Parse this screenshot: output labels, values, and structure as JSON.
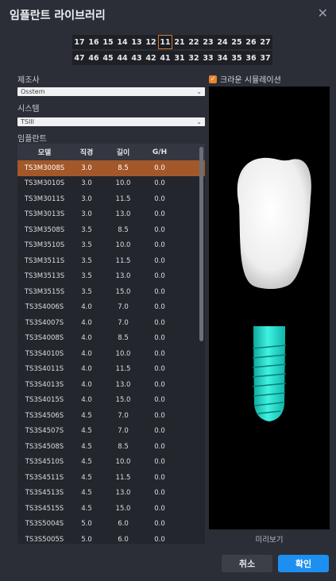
{
  "window": {
    "title": "임플란트 라이브러리"
  },
  "teeth": {
    "upper": [
      "17",
      "16",
      "15",
      "14",
      "13",
      "12",
      "11",
      "21",
      "22",
      "23",
      "24",
      "25",
      "26",
      "27"
    ],
    "lower": [
      "47",
      "46",
      "45",
      "44",
      "43",
      "42",
      "41",
      "31",
      "32",
      "33",
      "34",
      "35",
      "36",
      "37"
    ],
    "selected": "11"
  },
  "manufacturer": {
    "label": "제조사",
    "value": "Osstem"
  },
  "system": {
    "label": "시스템",
    "value": "TSIII"
  },
  "implant": {
    "label": "임플란트",
    "columns": [
      "모델",
      "직경",
      "길이",
      "G/H"
    ],
    "selected_index": 0,
    "rows": [
      [
        "TS3M3008S",
        "3.0",
        "8.5",
        "0.0"
      ],
      [
        "TS3M3010S",
        "3.0",
        "10.0",
        "0.0"
      ],
      [
        "TS3M3011S",
        "3.0",
        "11.5",
        "0.0"
      ],
      [
        "TS3M3013S",
        "3.0",
        "13.0",
        "0.0"
      ],
      [
        "TS3M3508S",
        "3.5",
        "8.5",
        "0.0"
      ],
      [
        "TS3M3510S",
        "3.5",
        "10.0",
        "0.0"
      ],
      [
        "TS3M3511S",
        "3.5",
        "11.5",
        "0.0"
      ],
      [
        "TS3M3513S",
        "3.5",
        "13.0",
        "0.0"
      ],
      [
        "TS3M3515S",
        "3.5",
        "15.0",
        "0.0"
      ],
      [
        "TS3S4006S",
        "4.0",
        "7.0",
        "0.0"
      ],
      [
        "TS3S4007S",
        "4.0",
        "7.0",
        "0.0"
      ],
      [
        "TS3S4008S",
        "4.0",
        "8.5",
        "0.0"
      ],
      [
        "TS3S4010S",
        "4.0",
        "10.0",
        "0.0"
      ],
      [
        "TS3S4011S",
        "4.0",
        "11.5",
        "0.0"
      ],
      [
        "TS3S4013S",
        "4.0",
        "13.0",
        "0.0"
      ],
      [
        "TS3S4015S",
        "4.0",
        "15.0",
        "0.0"
      ],
      [
        "TS3S4506S",
        "4.5",
        "7.0",
        "0.0"
      ],
      [
        "TS3S4507S",
        "4.5",
        "7.0",
        "0.0"
      ],
      [
        "TS3S4508S",
        "4.5",
        "8.5",
        "0.0"
      ],
      [
        "TS3S4510S",
        "4.5",
        "10.0",
        "0.0"
      ],
      [
        "TS3S4511S",
        "4.5",
        "11.5",
        "0.0"
      ],
      [
        "TS3S4513S",
        "4.5",
        "13.0",
        "0.0"
      ],
      [
        "TS3S4515S",
        "4.5",
        "15.0",
        "0.0"
      ],
      [
        "TS3S5004S",
        "5.0",
        "6.0",
        "0.0"
      ],
      [
        "TS3S5005S",
        "5.0",
        "6.0",
        "0.0"
      ]
    ]
  },
  "crown_sim": {
    "label": "크라운 시뮬레이션",
    "checked": true
  },
  "preview": {
    "caption": "미리보기"
  },
  "buttons": {
    "cancel": "취소",
    "ok": "확인"
  },
  "colors": {
    "accent": "#1d8ff0",
    "selection": "#a3582a",
    "checkbox": "#e8842c",
    "implant": "#1ee0d0",
    "crown": "#f2f2f2"
  }
}
